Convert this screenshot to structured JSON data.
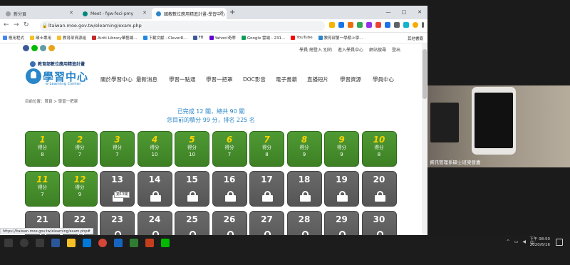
{
  "browser": {
    "tabs": [
      {
        "label": "新分頁",
        "active": false
      },
      {
        "label": "Meet - fgw-feci-pmy",
        "active": false
      },
      {
        "label": "國教數位應用精進計畫-學習中心",
        "active": true
      }
    ],
    "new_tab": "+",
    "window_controls": [
      "—",
      "□",
      "✕"
    ],
    "url": "ltaiwan.moe.gov.tw/elearning/exam.php",
    "bookmarks": [
      "應用程式",
      "碩士專用",
      "教育部資源組",
      "Airiti Library華藝線...",
      "下載文獻 - CleverR...",
      "FB",
      "Yahoo!奇摩",
      "Google 雲端 - 231...",
      "YouTube",
      "教育部第一學期上學..."
    ],
    "other_bookmarks": "其他書籤",
    "status_url": "https://ltaiwan.moe.gov.tw/elearning/exam.php#"
  },
  "site": {
    "top_links": [
      "學員 總登入 別的",
      "進入學員中心",
      "網站搜尋",
      "登出"
    ],
    "ministry": "教育部數位應用精進計畫",
    "logo_title": "學習中心",
    "logo_sub": "e-Learning Center",
    "nav": [
      "關於學習中心",
      "最新消息",
      "學習一點通",
      "學習一把罩",
      "DOC影音",
      "電子書籍",
      "直播短片",
      "學習資源",
      "學員中心"
    ],
    "breadcrumb": "目前位置：首頁 > 學習一把罩",
    "progress_line1": "已完成 12 關，總共 90 關",
    "progress_line2": "您目前的積分 99 分，排名 225 名",
    "score_label": "得分",
    "tooltip": "第13關",
    "levels": [
      {
        "num": "1",
        "score": "8"
      },
      {
        "num": "2",
        "score": "7"
      },
      {
        "num": "3",
        "score": "7"
      },
      {
        "num": "4",
        "score": "10"
      },
      {
        "num": "5",
        "score": "10"
      },
      {
        "num": "6",
        "score": "7"
      },
      {
        "num": "7",
        "score": "8"
      },
      {
        "num": "8",
        "score": "9"
      },
      {
        "num": "9",
        "score": "9"
      },
      {
        "num": "10",
        "score": "8"
      },
      {
        "num": "11",
        "score": "7"
      },
      {
        "num": "12",
        "score": "9"
      },
      {
        "num": "13",
        "score": null
      },
      {
        "num": "14",
        "score": null
      },
      {
        "num": "15",
        "score": null
      },
      {
        "num": "16",
        "score": null
      },
      {
        "num": "17",
        "score": null
      },
      {
        "num": "18",
        "score": null
      },
      {
        "num": "19",
        "score": null
      },
      {
        "num": "20",
        "score": null
      },
      {
        "num": "21",
        "score": null
      },
      {
        "num": "22",
        "score": null
      },
      {
        "num": "23",
        "score": null
      },
      {
        "num": "24",
        "score": null
      },
      {
        "num": "25",
        "score": null
      },
      {
        "num": "26",
        "score": null
      },
      {
        "num": "27",
        "score": null
      },
      {
        "num": "28",
        "score": null
      },
      {
        "num": "29",
        "score": null
      },
      {
        "num": "30",
        "score": null
      }
    ]
  },
  "video": {
    "caption": "資訊管理系碩士班梁晉嘉"
  },
  "taskbar": {
    "time": "下午 08:50",
    "date": "2020/6/16"
  },
  "colors": {
    "completed": "#4f9a34",
    "locked": "#5f5f5f",
    "number": "#f5d400",
    "accent": "#2b86c9"
  }
}
